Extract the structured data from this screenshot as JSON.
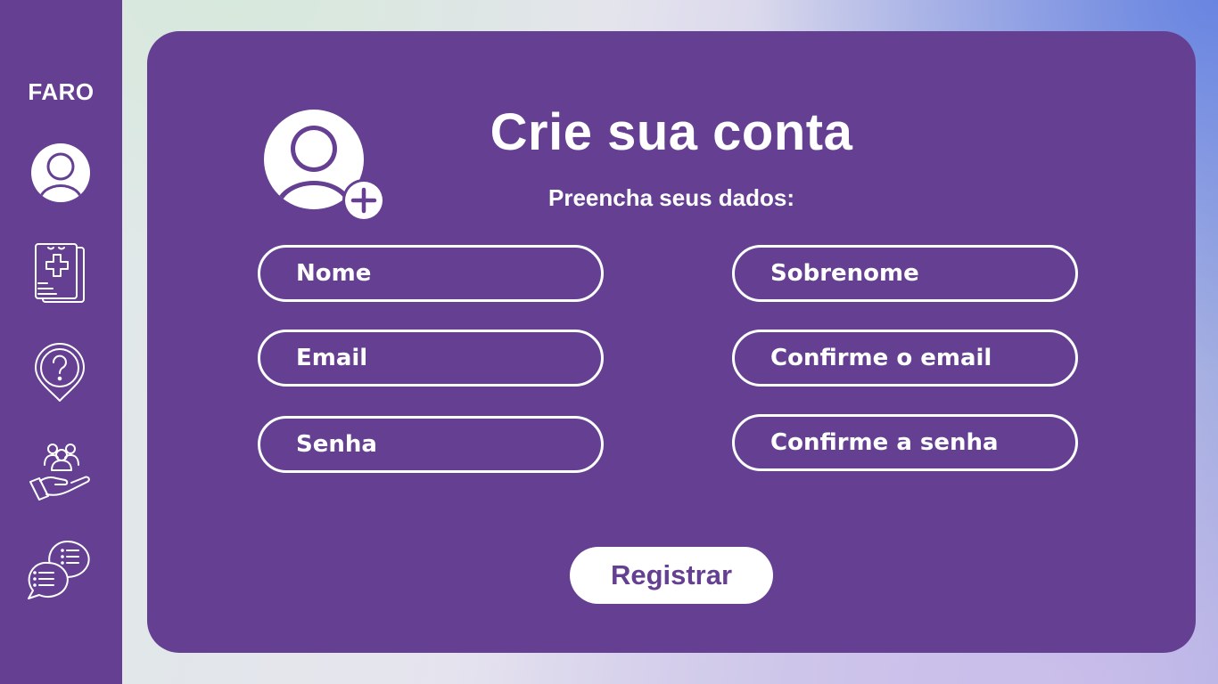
{
  "sidebar": {
    "logo": "FARO",
    "items": [
      {
        "icon": "user-circle-icon"
      },
      {
        "icon": "medical-record-icon"
      },
      {
        "icon": "location-question-icon"
      },
      {
        "icon": "community-care-icon"
      },
      {
        "icon": "chat-bubbles-icon"
      }
    ]
  },
  "form": {
    "icon": "add-user-icon",
    "title": "Crie sua conta",
    "subtitle": "Preencha seus dados:",
    "fields": {
      "first_name": {
        "placeholder": "Nome",
        "value": ""
      },
      "last_name": {
        "placeholder": "Sobrenome",
        "value": ""
      },
      "email": {
        "placeholder": "Email",
        "value": ""
      },
      "confirm_email": {
        "placeholder": "Confirme o email",
        "value": ""
      },
      "password": {
        "placeholder": "Senha",
        "value": ""
      },
      "confirm_password": {
        "placeholder": "Confirme a senha",
        "value": ""
      }
    },
    "submit_label": "Registrar"
  },
  "colors": {
    "primary": "#654092",
    "text_light": "#ffffff"
  }
}
